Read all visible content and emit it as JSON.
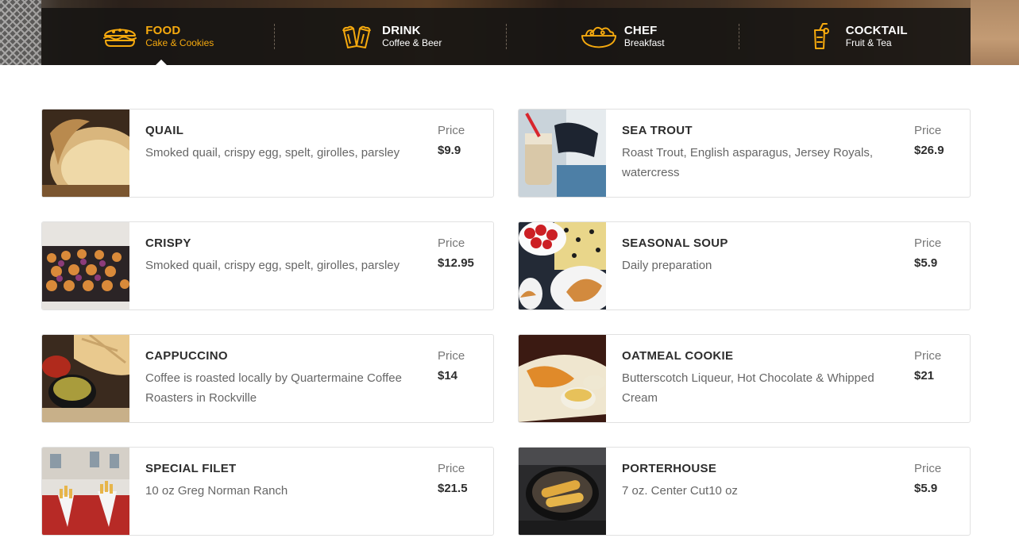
{
  "tabs": [
    {
      "title": "FOOD",
      "subtitle": "Cake & Cookies",
      "icon": "sandwich-icon",
      "active": true
    },
    {
      "title": "DRINK",
      "subtitle": "Coffee & Beer",
      "icon": "beer-mugs-icon",
      "active": false
    },
    {
      "title": "CHEF",
      "subtitle": "Breakfast",
      "icon": "salad-bowl-icon",
      "active": false
    },
    {
      "title": "COCKTAIL",
      "subtitle": "Fruit & Tea",
      "icon": "cocktail-glass-icon",
      "active": false
    }
  ],
  "accent_color": "#f5a90e",
  "menu": [
    {
      "name": "QUAIL",
      "description": "Smoked quail, crispy egg, spelt, girolles, parsley",
      "price_label": "Price",
      "price": "$9.9",
      "image": "bread-image"
    },
    {
      "name": "SEA TROUT",
      "description": "Roast Trout, English asparagus, Jersey Royals, watercress",
      "price_label": "Price",
      "price": "$26.9",
      "image": "milkshake-sunglasses-image"
    },
    {
      "name": "CRISPY",
      "description": "Smoked quail, crispy egg, spelt, girolles, parsley",
      "price_label": "Price",
      "price": "$12.95",
      "image": "canapes-image"
    },
    {
      "name": "SEASONAL SOUP",
      "description": "Daily preparation",
      "price_label": "Price",
      "price": "$5.9",
      "image": "strawberries-croissant-image"
    },
    {
      "name": "CAPPUCCINO",
      "description": "Coffee is roasted locally by Quartermaine Coffee Roasters in Rockville",
      "price_label": "Price",
      "price": "$14",
      "image": "chips-dips-image"
    },
    {
      "name": "OATMEAL COOKIE",
      "description": "Butterscotch Liqueur, Hot Chocolate & Whipped Cream",
      "price_label": "Price",
      "price": "$21",
      "image": "corn-plate-image"
    },
    {
      "name": "SPECIAL FILET",
      "description": "10 oz Greg Norman Ranch",
      "price_label": "Price",
      "price": "$21.5",
      "image": "fries-cones-image"
    },
    {
      "name": "PORTERHOUSE",
      "description": "7 oz. Center Cut10 oz",
      "price_label": "Price",
      "price": "$5.9",
      "image": "fried-corn-pot-image"
    }
  ]
}
